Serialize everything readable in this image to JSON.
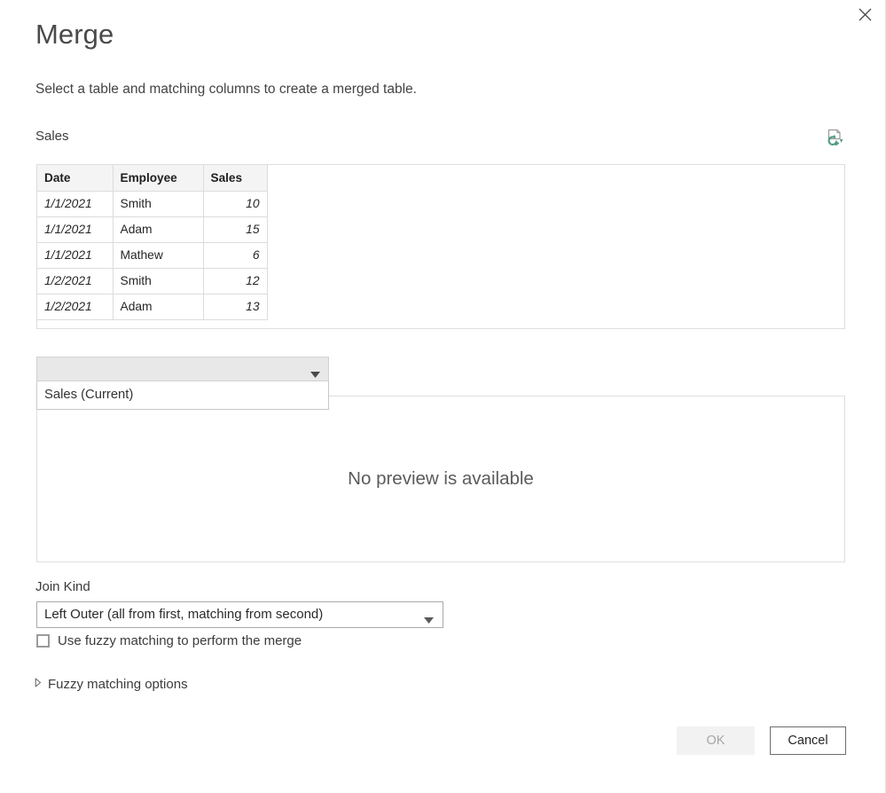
{
  "dialog": {
    "title": "Merge",
    "subtitle": "Select a table and matching columns to create a merged table.",
    "close_icon": "close-icon"
  },
  "first_table": {
    "label": "Sales",
    "refresh_icon": "refresh-preview-icon",
    "columns": [
      "Date",
      "Employee",
      "Sales"
    ],
    "rows": [
      [
        "1/1/2021",
        "Smith",
        "10"
      ],
      [
        "1/1/2021",
        "Adam",
        "15"
      ],
      [
        "1/1/2021",
        "Mathew",
        "6"
      ],
      [
        "1/2/2021",
        "Smith",
        "12"
      ],
      [
        "1/2/2021",
        "Adam",
        "13"
      ]
    ]
  },
  "table_selector": {
    "selected": "",
    "placeholder": "",
    "caret_icon": "chevron-down-icon",
    "options": [
      "Sales (Current)"
    ],
    "expanded": true
  },
  "preview": {
    "message": "No preview is available"
  },
  "join_kind": {
    "label": "Join Kind",
    "selected": "Left Outer (all from first, matching from second)",
    "caret_icon": "chevron-down-icon"
  },
  "fuzzy": {
    "checkbox_label": "Use fuzzy matching to perform the merge",
    "checked": false,
    "options_label": "Fuzzy matching options",
    "options_expanded": false,
    "expander_icon": "triangle-right-icon"
  },
  "footer": {
    "ok_label": "OK",
    "ok_enabled": false,
    "cancel_label": "Cancel"
  },
  "colors": {
    "accent_green": "#4f9e7f",
    "header_bg": "#f4f4f4",
    "dropdown_bg": "#e8e8e8",
    "text": "#3c3c3c",
    "muted": "#a6a6a6"
  }
}
